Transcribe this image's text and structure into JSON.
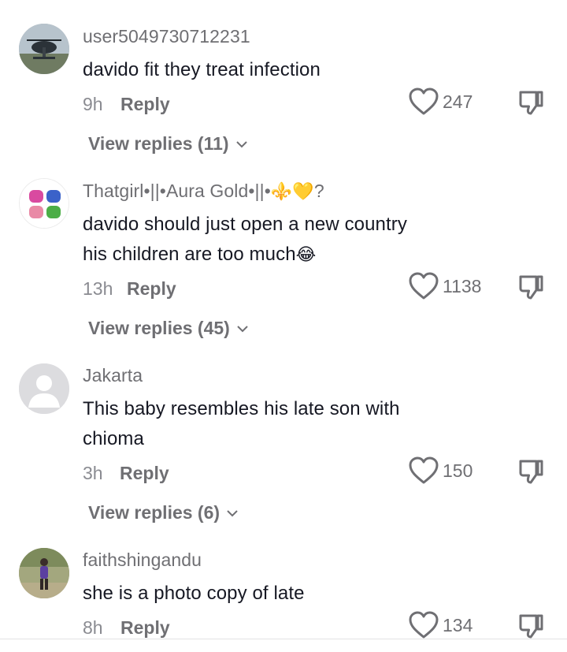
{
  "comments": [
    {
      "username": "user5049730712231",
      "text_lines": [
        "davido fit they treat infection"
      ],
      "time": "9h",
      "reply_label": "Reply",
      "likes": "247",
      "view_replies": "View replies (11)"
    },
    {
      "username": "Thatgirl•||•Aura Gold•||•",
      "username_emoji": "⚜️💛",
      "username_suffix": "?",
      "text_lines": [
        "davido should just open a new country",
        "his children are too much"
      ],
      "text_emoji": "😂",
      "time": "13h",
      "reply_label": "Reply",
      "likes": "1138",
      "view_replies": "View replies (45)"
    },
    {
      "username": "Jakarta",
      "text_lines": [
        "This baby resembles his late son with",
        "chioma"
      ],
      "time": "3h",
      "reply_label": "Reply",
      "likes": "150",
      "view_replies": "View replies (6)"
    },
    {
      "username": "faithshingandu",
      "text_lines": [
        "she is a photo copy of late"
      ],
      "time": "8h",
      "reply_label": "Reply",
      "likes": "134"
    }
  ],
  "icons": {
    "like": "heart-outline-icon",
    "dislike": "thumbs-down-icon",
    "expand": "chevron-down-icon"
  },
  "colors": {
    "text": "#161823",
    "secondary": "#6f6f73",
    "icon": "#6f6f73"
  }
}
